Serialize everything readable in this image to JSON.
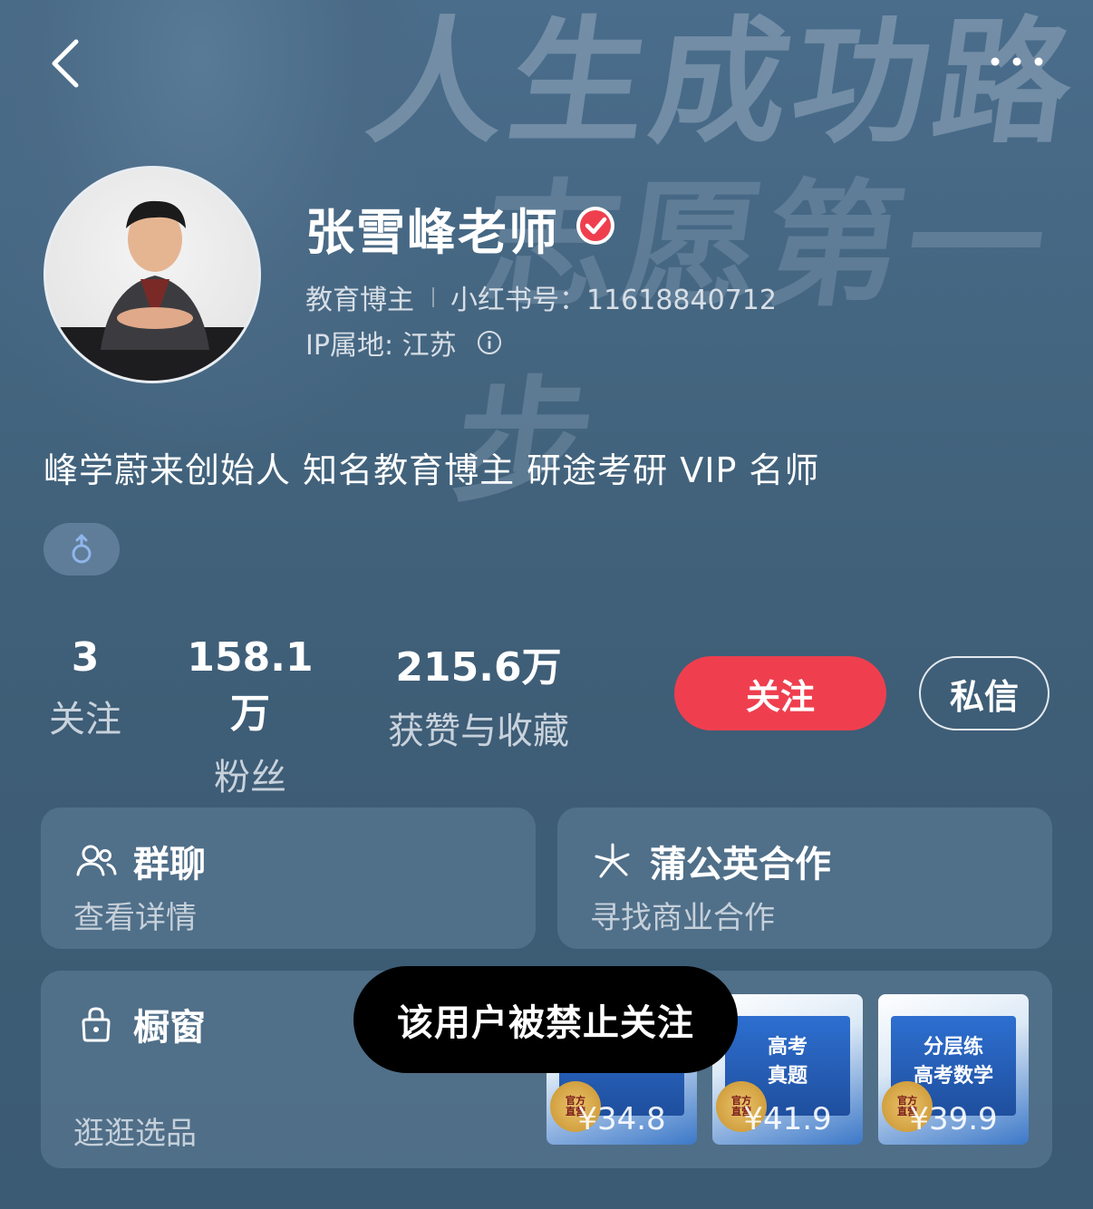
{
  "profile": {
    "name": "张雪峰老师",
    "category": "教育博主",
    "red_id": "小红书号：11618840712",
    "ip_location": "IP属地: 江苏",
    "bio": "峰学蔚来创始人 知名教育博主 研途考研 VIP 名师"
  },
  "stats": {
    "following_count": "3",
    "following_label": "关注",
    "fans_count": "158.1万",
    "fans_label": "粉丝",
    "likes_count": "215.6万",
    "likes_label": "获赞与收藏"
  },
  "actions": {
    "follow_label": "关注",
    "message_label": "私信"
  },
  "cards": {
    "group": {
      "title": "群聊",
      "subtitle": "查看详情"
    },
    "cooperation": {
      "title": "蒲公英合作",
      "subtitle": "寻找商业合作"
    },
    "shop": {
      "title": "橱窗",
      "subtitle": "逛逛选品",
      "products": [
        {
          "price": "¥34.8"
        },
        {
          "price": "¥41.9"
        },
        {
          "price": "¥39.9"
        }
      ]
    }
  },
  "toast": "该用户被禁止关注",
  "colors": {
    "background": "#3f5f79",
    "follow_button": "#ef3f4f",
    "verified": "#ef3f4f",
    "gender_icon": "#8fb6ea"
  },
  "icons": {
    "back": "chevron-left-icon",
    "more": "more-dots-icon",
    "verified": "verified-badge-icon",
    "info": "info-icon",
    "gender": "male-icon",
    "group": "people-icon",
    "cooperation": "dandelion-icon",
    "shop": "shopping-bag-icon"
  }
}
